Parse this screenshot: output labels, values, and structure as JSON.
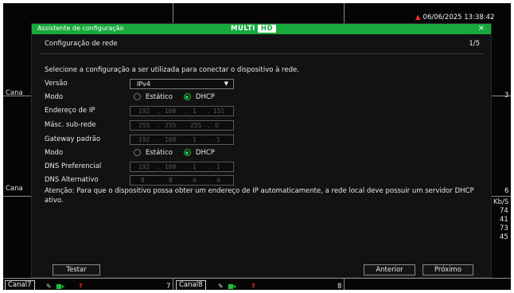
{
  "status": {
    "datetime": "06/06/2025 13:38:42"
  },
  "dialog": {
    "title": "Assistente de configuração",
    "logo": {
      "main": "MULTI",
      "badge": "HD"
    },
    "close_label": "×",
    "heading": "Configuração de rede",
    "step": "1/5",
    "intro": "Selecione a configuração a ser utilizada para conectar o dispositivo à rede.",
    "version": {
      "label": "Versão",
      "value": "IPv4"
    },
    "ip_mode": {
      "label": "Modo",
      "static": "Estático",
      "dhcp": "DHCP",
      "selected": "DHCP"
    },
    "ip_address": {
      "label": "Endereço de IP",
      "octets": [
        "192",
        "168",
        "1",
        "151"
      ]
    },
    "subnet": {
      "label": "Másc. sub-rede",
      "octets": [
        "255",
        "255",
        "255",
        "0"
      ]
    },
    "gateway": {
      "label": "Gateway padrão",
      "octets": [
        "192",
        "168",
        "1",
        "1"
      ]
    },
    "dns_mode": {
      "label": "Modo",
      "static": "Estático",
      "dhcp": "DHCP",
      "selected": "DHCP"
    },
    "dns_pref": {
      "label": "DNS Preferencial",
      "octets": [
        "192",
        "168",
        "1",
        "1"
      ]
    },
    "dns_alt": {
      "label": "DNS Alternativo",
      "octets": [
        "8",
        "8",
        "4",
        "4"
      ]
    },
    "warning": "Atenção: Para que o dispositivo possa obter um endereço de IP automaticamente, a rede local deve possuir um servidor DHCP ativo.",
    "buttons": {
      "test": "Testar",
      "back": "Anterior",
      "next": "Próximo"
    }
  },
  "background": {
    "left_tags": [
      "Cana",
      "Cana"
    ],
    "right_numbers": [
      "3",
      "6"
    ],
    "rate_unit": "Kb/S",
    "rates": [
      "74",
      "41",
      "73",
      "45"
    ],
    "channels": [
      {
        "label": "Canal7",
        "number": "7"
      },
      {
        "label": "Canal8",
        "number": "8"
      }
    ],
    "alert_glyph": "?"
  },
  "icons": {
    "alarm": "alarm-bell-icon",
    "edit": "pencil-icon",
    "record": "camera-icon",
    "close": "close-icon",
    "dropdown": "chevron-down-icon"
  },
  "colors": {
    "accent": "#18a93c",
    "alert": "#ff2a2a",
    "radio_on": "#23c447"
  }
}
